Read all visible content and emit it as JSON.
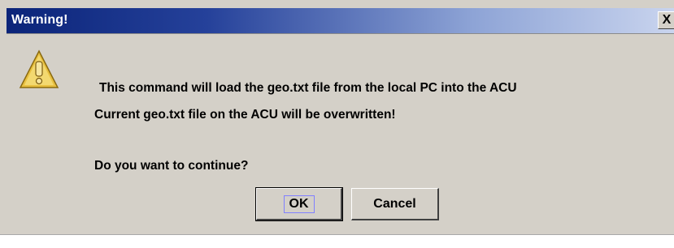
{
  "dialog": {
    "title": "Warning!",
    "close_glyph": "X",
    "icon": "warning-triangle-icon",
    "message_line1": "This command will load the geo.txt file from the local PC into the ACU",
    "message_line2": "Current geo.txt file on the ACU will be overwritten!",
    "question": "Do you want to continue?",
    "ok_label": "OK",
    "cancel_label": "Cancel"
  },
  "colors": {
    "titlebar_start": "#0b2479",
    "titlebar_end": "#c9d4ee",
    "dialog_bg": "#d4d0c8",
    "icon_fill": "#e8c040"
  }
}
